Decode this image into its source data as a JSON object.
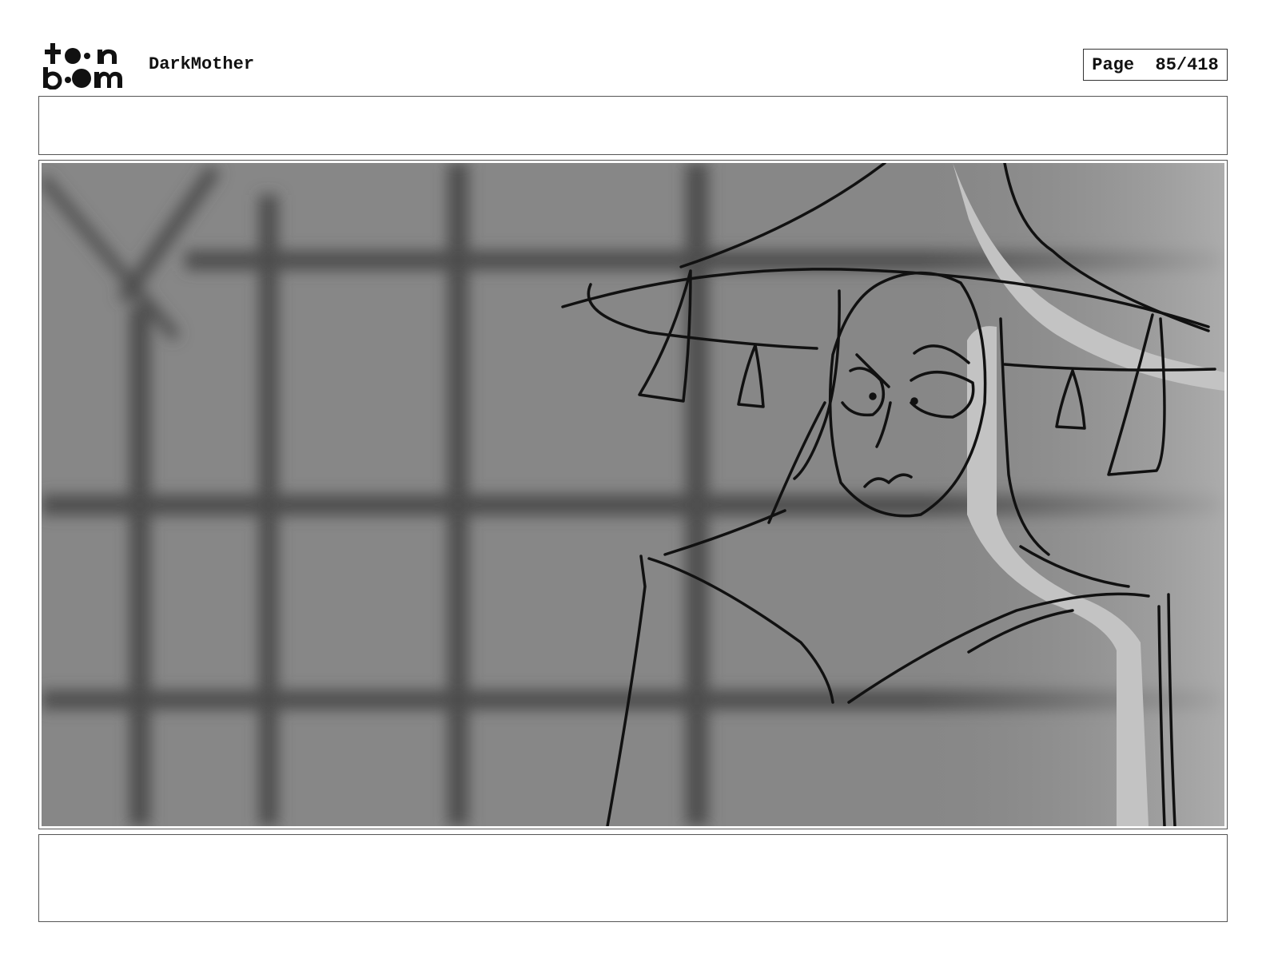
{
  "header": {
    "logo_text": "toon boom",
    "project_title": "DarkMother",
    "page_label": "Page",
    "page_number": "85/418"
  },
  "notes": {
    "top": "",
    "bottom": ""
  },
  "panel": {
    "description_colors": {
      "background": "#8a8a8a",
      "grid_shadow": "#4a4a4a",
      "highlight": "#c4c4c4",
      "line": "#111111"
    }
  }
}
